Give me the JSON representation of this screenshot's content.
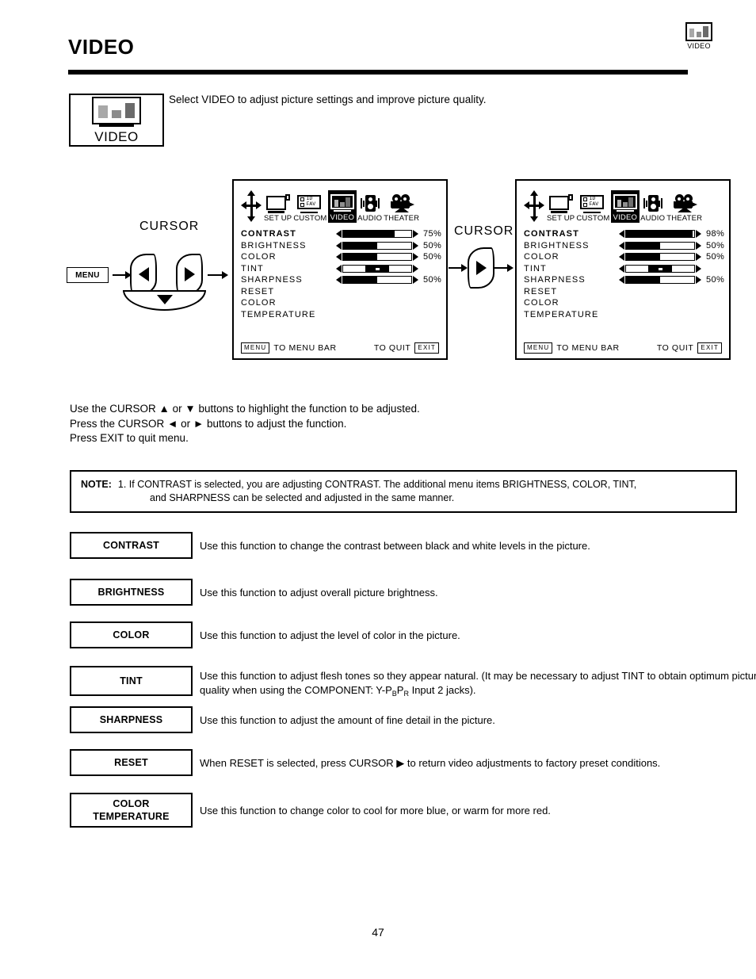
{
  "header": {
    "title": "VIDEO",
    "badge_label": "VIDEO",
    "badge_icon": "video-bars-tv-icon"
  },
  "intro": {
    "legend_label": "VIDEO",
    "legend_icon": "video-bars-tv-icon",
    "text": "Select VIDEO to adjust picture settings and improve picture quality."
  },
  "remote_diagram": {
    "cursor_label": "CURSOR",
    "menu_button_label": "MENU",
    "left_arrow_icon": "cursor-left-icon",
    "right_arrow_icon": "cursor-right-icon",
    "down_arrow_icon": "cursor-down-icon",
    "flow_arrow_icon": "flow-arrow-icon"
  },
  "mid_diagram": {
    "cursor_label": "CURSOR",
    "right_arrow_icon": "cursor-right-icon",
    "flow_arrow_icon": "flow-arrow-icon"
  },
  "osd_menubar": {
    "navpad_icon": "navpad-icon",
    "items": [
      {
        "label": "SET UP",
        "icon": "setup-tv-icon",
        "selected": false
      },
      {
        "label": "CUSTOM",
        "icon": "custom-id-fav-icon",
        "selected": false,
        "card_line1": "ID",
        "card_line2": "FAV"
      },
      {
        "label": "VIDEO",
        "icon": "video-bars-tv-icon",
        "selected": true
      },
      {
        "label": "AUDIO",
        "icon": "audio-speaker-icon",
        "selected": false
      },
      {
        "label": "THEATER",
        "icon": "theater-camera-icon",
        "selected": false
      }
    ]
  },
  "osd_left": {
    "rows": [
      {
        "name": "CONTRAST",
        "bold": true,
        "type": "bar",
        "percent": 75,
        "value": "75%"
      },
      {
        "name": "BRIGHTNESS",
        "bold": false,
        "type": "bar",
        "percent": 50,
        "value": "50%"
      },
      {
        "name": "COLOR",
        "bold": false,
        "type": "bar",
        "percent": 50,
        "value": "50%"
      },
      {
        "name": "TINT",
        "bold": false,
        "type": "center",
        "percent": 50,
        "value": ""
      },
      {
        "name": "SHARPNESS",
        "bold": false,
        "type": "bar",
        "percent": 50,
        "value": "50%"
      },
      {
        "name": "RESET",
        "bold": false,
        "type": "none",
        "value": ""
      },
      {
        "name": "COLOR",
        "bold": false,
        "type": "none",
        "value": ""
      },
      {
        "name": "   TEMPERATURE",
        "bold": false,
        "type": "none",
        "value": ""
      }
    ],
    "footer": {
      "menu_key": "MENU",
      "menu_text": "TO MENU BAR",
      "quit_text": "TO QUIT",
      "exit_key": "EXIT"
    }
  },
  "osd_right": {
    "rows": [
      {
        "name": "CONTRAST",
        "bold": true,
        "type": "bar",
        "percent": 98,
        "value": "98%"
      },
      {
        "name": "BRIGHTNESS",
        "bold": false,
        "type": "bar",
        "percent": 50,
        "value": "50%"
      },
      {
        "name": "COLOR",
        "bold": false,
        "type": "bar",
        "percent": 50,
        "value": "50%"
      },
      {
        "name": "TINT",
        "bold": false,
        "type": "center",
        "percent": 50,
        "value": ""
      },
      {
        "name": "SHARPNESS",
        "bold": false,
        "type": "bar",
        "percent": 50,
        "value": "50%"
      },
      {
        "name": "RESET",
        "bold": false,
        "type": "none",
        "value": ""
      },
      {
        "name": "COLOR",
        "bold": false,
        "type": "none",
        "value": ""
      },
      {
        "name": "   TEMPERATURE",
        "bold": false,
        "type": "none",
        "value": ""
      }
    ],
    "footer": {
      "menu_key": "MENU",
      "menu_text": "TO MENU BAR",
      "quit_text": "TO QUIT",
      "exit_key": "EXIT"
    }
  },
  "usage": {
    "line1": "Use the CURSOR ▲ or ▼ buttons to highlight the function to be adjusted.",
    "line2": "Press the CURSOR ◄ or ► buttons to adjust the function.",
    "line3": "Press EXIT to quit menu."
  },
  "note": {
    "label": "NOTE:",
    "line1": "1. If CONTRAST is selected, you are adjusting CONTRAST.  The additional menu items BRIGHTNESS, COLOR, TINT,",
    "line2": "and SHARPNESS can be selected and adjusted in the same manner."
  },
  "functions": [
    {
      "key": "CONTRAST",
      "desc": "Use this function to change the contrast between black and white levels in the picture."
    },
    {
      "key": "BRIGHTNESS",
      "desc": "Use this function to adjust overall picture brightness."
    },
    {
      "key": "COLOR",
      "desc": "Use this function to adjust the level of color in the picture."
    },
    {
      "key": "TINT",
      "desc_part1": "Use this function to adjust flesh tones so they appear natural. (It may be necessary to adjust TINT to obtain optimum picture quality when using the COMPONENT: Y-P",
      "desc_sub1": "B",
      "desc_part2": "P",
      "desc_sub2": "R",
      "desc_part3": " Input 2 jacks)."
    },
    {
      "key": "SHARPNESS",
      "desc": "Use this function to adjust the amount of fine detail in the picture."
    },
    {
      "key": "RESET",
      "desc": "When RESET is selected, press CURSOR ▶ to return video adjustments to factory preset conditions."
    },
    {
      "key_line1": "COLOR",
      "key_line2": "TEMPERATURE",
      "desc": "Use this function to change color to cool for more blue, or warm for more red."
    }
  ],
  "page_number": "47"
}
